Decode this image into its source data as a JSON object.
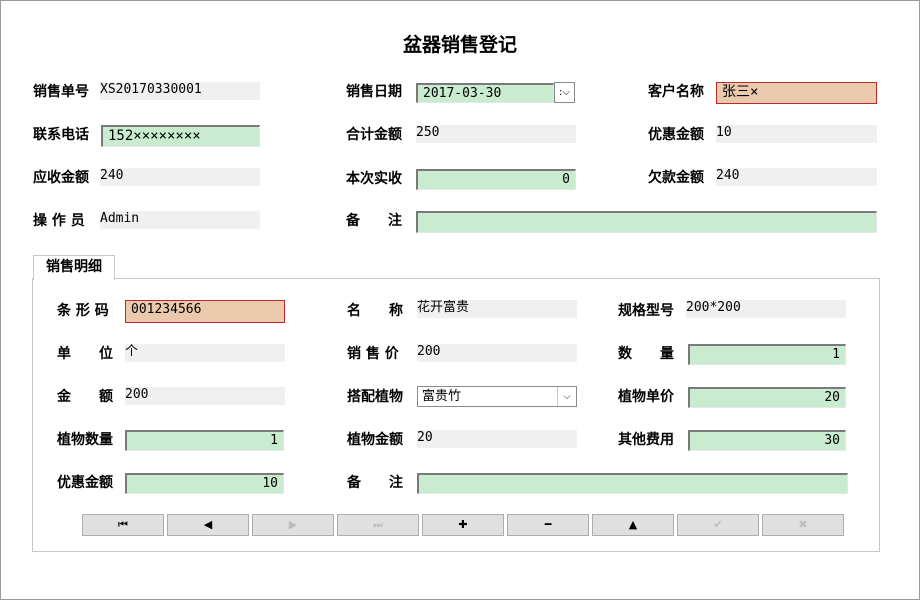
{
  "title": "盆器销售登记",
  "header": {
    "order_no_label": "销售单号",
    "order_no": "XS20170330001",
    "date_label": "销售日期",
    "date": "2017-03-30",
    "customer_label": "客户名称",
    "customer": "张三×",
    "phone_label": "联系电话",
    "phone": "152××××××××",
    "total_label": "合计金额",
    "total": "250",
    "discount_label": "优惠金额",
    "discount": "10",
    "receivable_label": "应收金额",
    "receivable": "240",
    "paid_label": "本次实收",
    "paid": "0",
    "debt_label": "欠款金额",
    "debt": "240",
    "operator_label": "操 作 员",
    "operator": "Admin",
    "remark_label": "备　　注",
    "remark": ""
  },
  "detail": {
    "tab_label": "销售明细",
    "barcode_label": "条 形 码",
    "barcode": "001234566",
    "name_label": "名　　称",
    "name": "花开富贵",
    "spec_label": "规格型号",
    "spec": "200*200",
    "unit_label": "单　　位",
    "unit": "个",
    "price_label": "销 售 价",
    "price": "200",
    "qty_label": "数　　量",
    "qty": "1",
    "amount_label": "金　　额",
    "amount": "200",
    "plant_label": "搭配植物",
    "plant": "富贵竹",
    "plant_price_label": "植物单价",
    "plant_price": "20",
    "plant_qty_label": "植物数量",
    "plant_qty": "1",
    "plant_amount_label": "植物金额",
    "plant_amount": "20",
    "other_fee_label": "其他费用",
    "other_fee": "30",
    "discount_label": "优惠金额",
    "discount": "10",
    "remark_label": "备　　注",
    "remark": ""
  },
  "navigator": {
    "first": "⏮",
    "prior": "◀",
    "next": "▶",
    "last": "⏭",
    "insert": "✚",
    "delete": "━",
    "edit": "▲",
    "post": "✔",
    "cancel": "✖"
  }
}
